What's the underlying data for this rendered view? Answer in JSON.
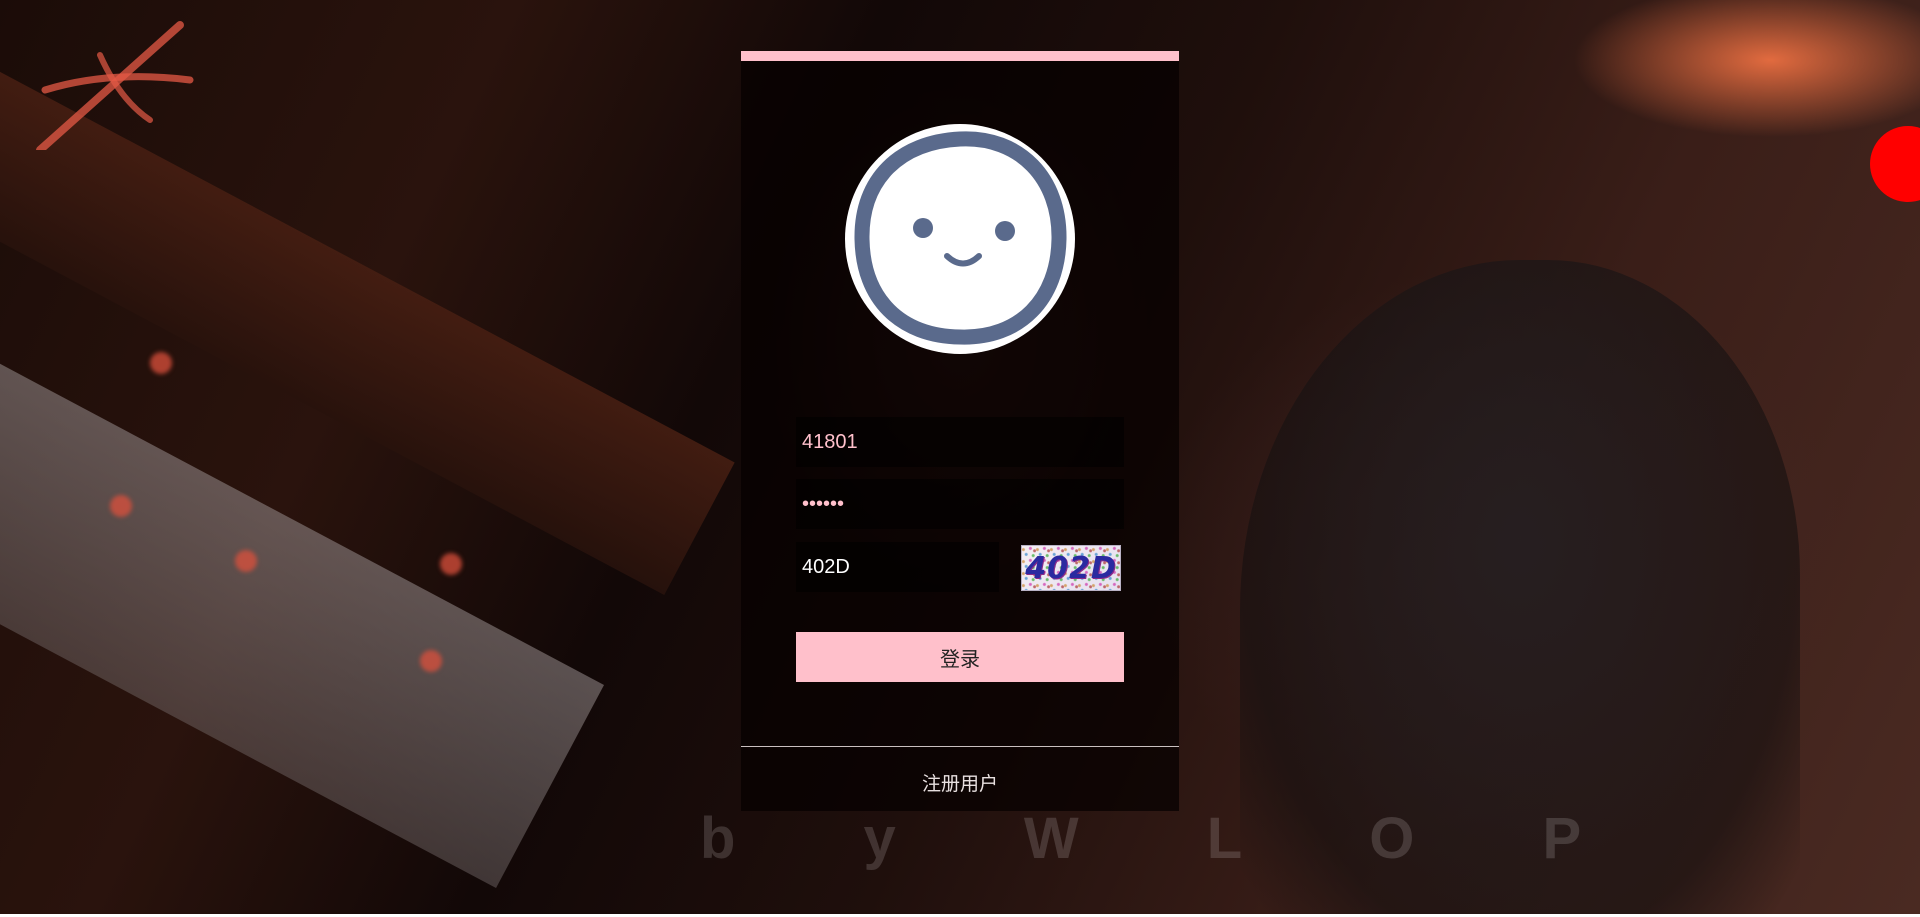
{
  "login_form": {
    "username_value": "41801",
    "password_value": "••••••",
    "captcha_value": "402D",
    "captcha_image_text": "402D",
    "login_label": "登录",
    "register_label": "注册用户"
  },
  "background": {
    "watermark": "b y   W L O P"
  },
  "colors": {
    "accent": "#ffc0cb",
    "panel": "#050000",
    "status_dot": "#ff0000"
  },
  "icons": {
    "avatar": "smiley-face-icon",
    "status": "red-dot-icon"
  }
}
